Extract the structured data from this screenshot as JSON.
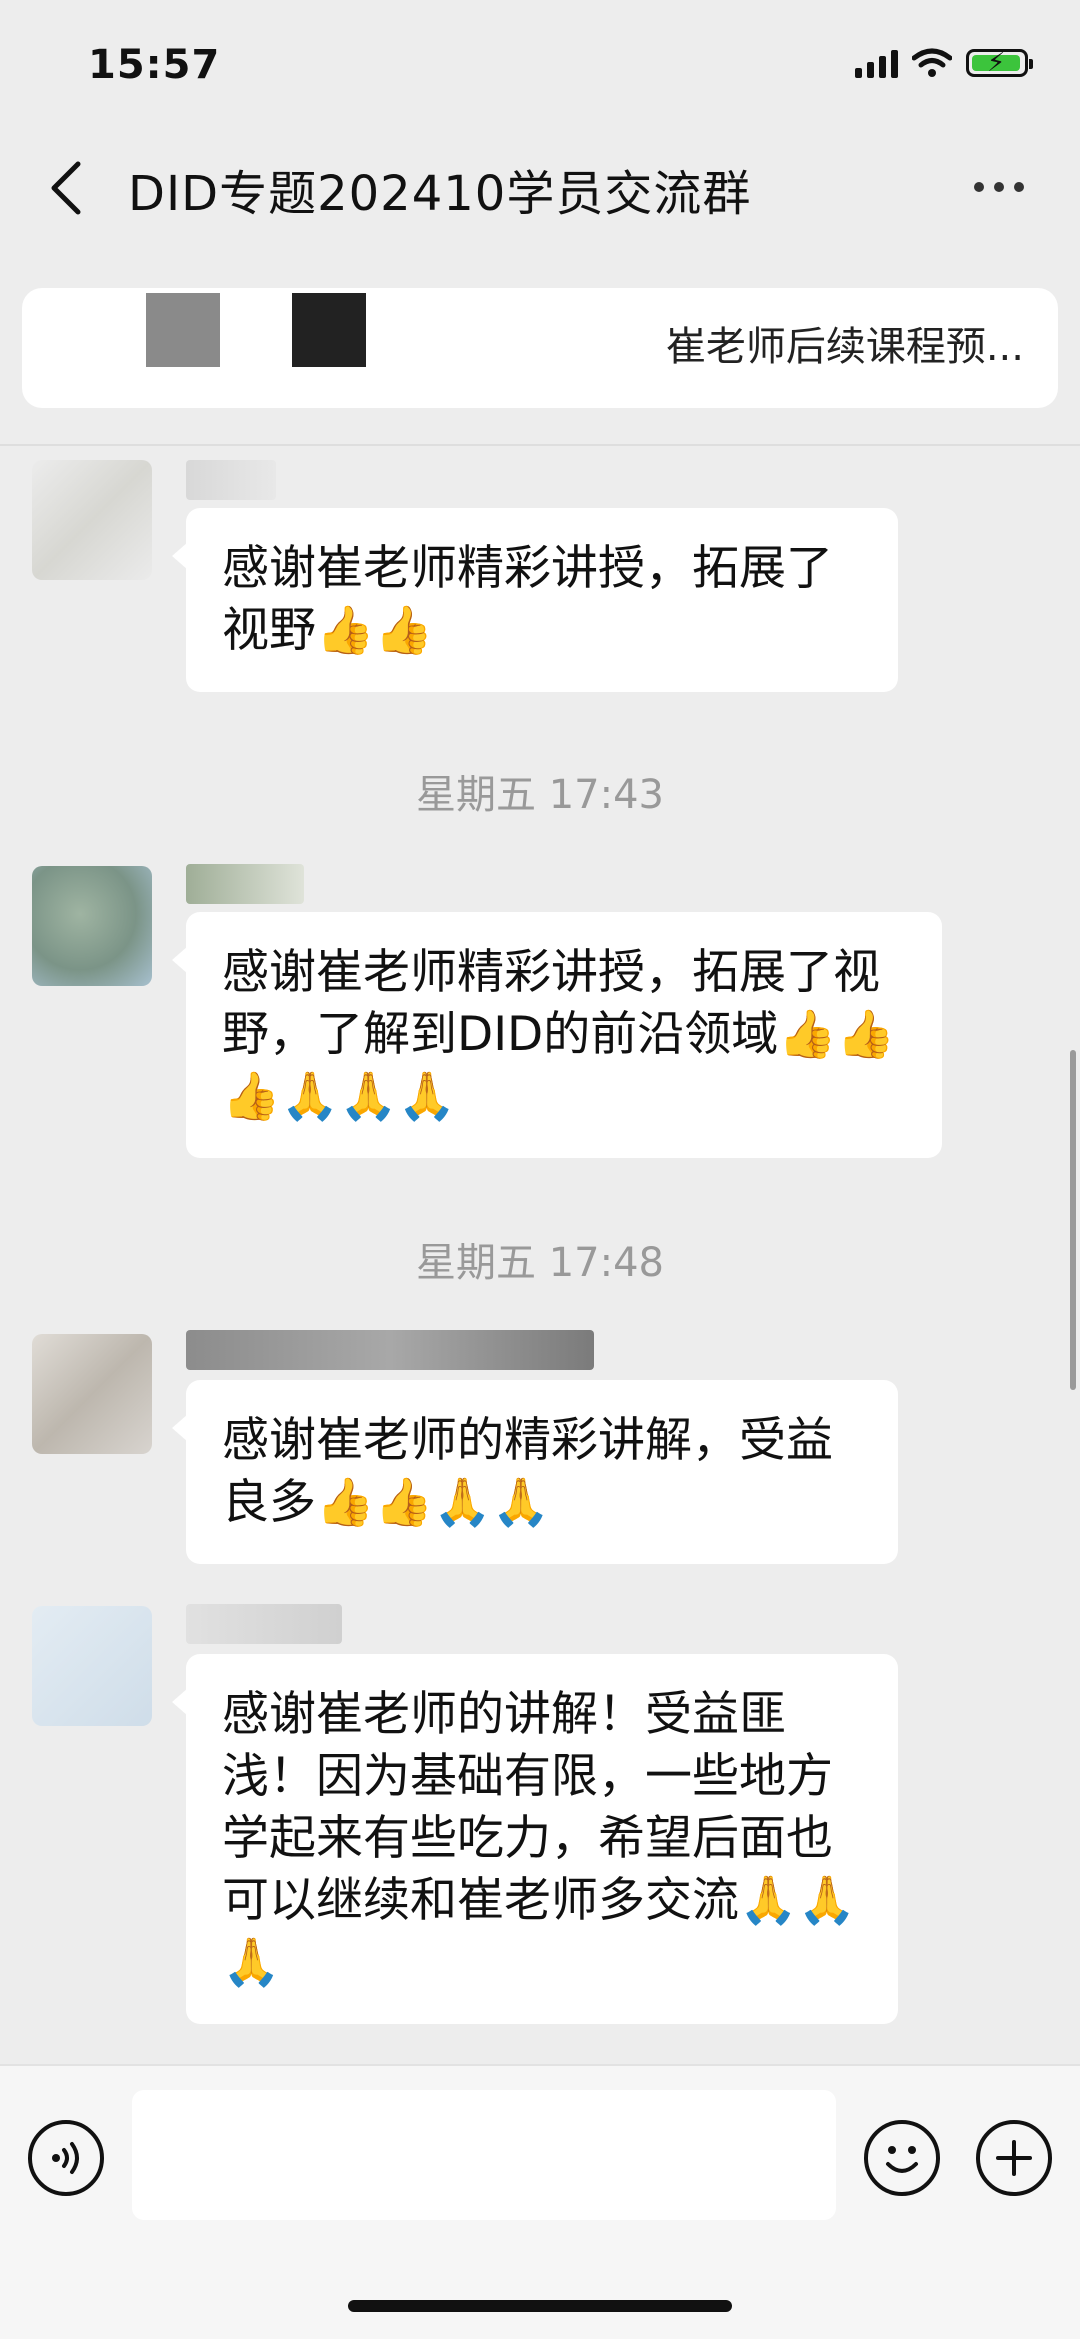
{
  "status": {
    "time": "15:57"
  },
  "header": {
    "title": "DID专题202410学员交流群"
  },
  "pinned": {
    "text": "崔老师后续课程预..."
  },
  "messages": [
    {
      "text": "感谢崔老师精彩讲授，拓展了视野👍👍"
    },
    {
      "text": "感谢崔老师精彩讲授，拓展了视野，了解到DID的前沿领域👍👍👍🙏🙏🙏"
    },
    {
      "text": "感谢崔老师的精彩讲解，受益良多👍👍🙏🙏"
    },
    {
      "text": "感谢崔老师的讲解！受益匪浅！因为基础有限，一些地方学起来有些吃力，希望后面也可以继续和崔老师多交流🙏🙏🙏"
    }
  ],
  "timestamps": [
    "星期五 17:43",
    "星期五 17:48"
  ],
  "icons": {
    "back": "back-chevron-icon",
    "more": "more-dots-icon",
    "voice": "voice-icon",
    "emoji": "emoji-icon",
    "plus": "plus-icon"
  },
  "colors": {
    "background": "#ededed",
    "bubble": "#ffffff",
    "battery": "#3cc43c"
  }
}
